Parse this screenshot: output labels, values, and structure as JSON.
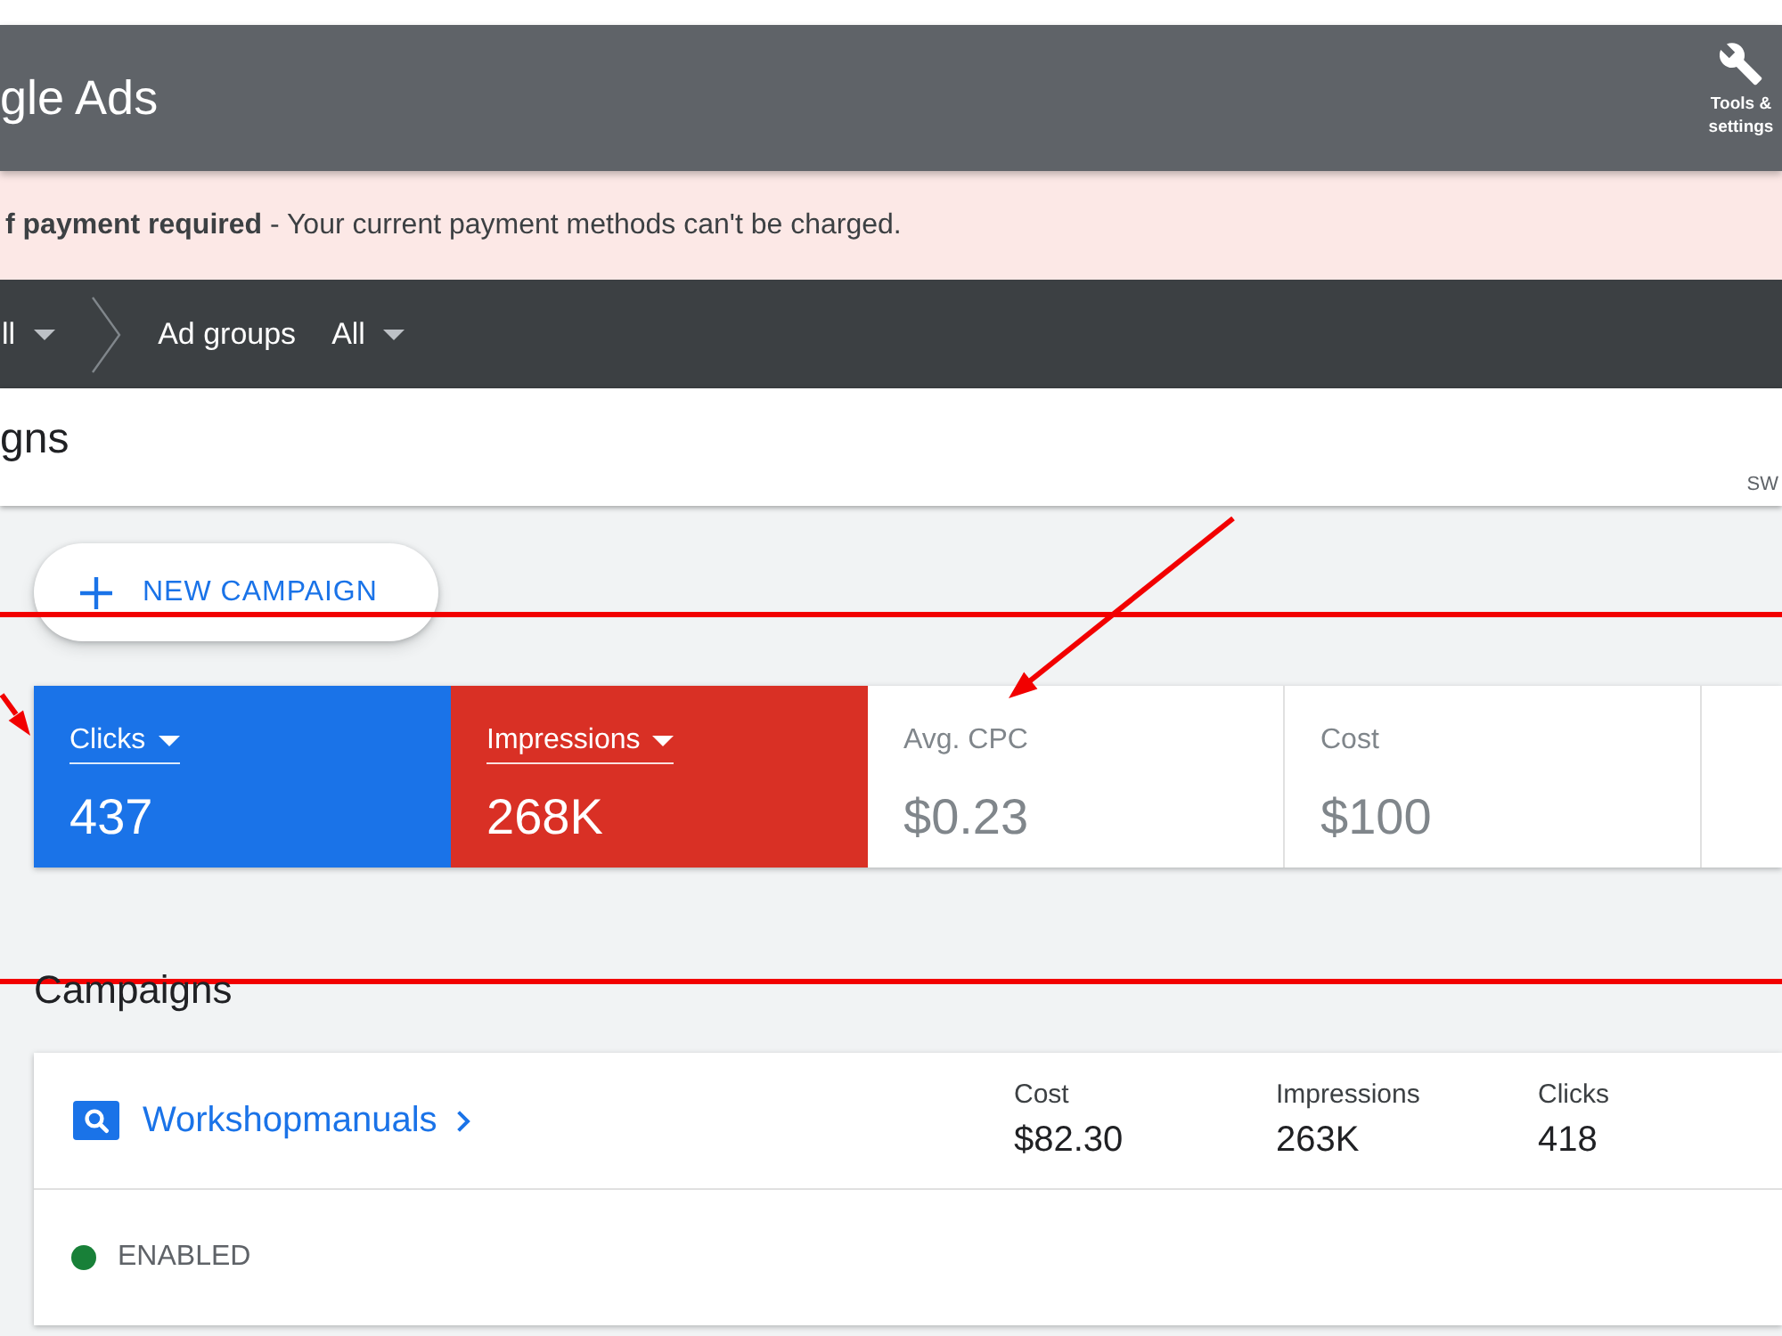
{
  "header": {
    "logo_text": "gle Ads",
    "tools_label": "Tools & settings"
  },
  "alert": {
    "message": "**f payment required** - Your current payment methods can't be charged."
  },
  "breadcrumbs": [
    {
      "filter": "ll"
    },
    {
      "label": "Ad groups",
      "filter": "All"
    }
  ],
  "title_bar": {
    "title": "gns",
    "corner_text": "SW"
  },
  "new_campaign_button": {
    "label": "NEW CAMPAIGN"
  },
  "metrics": [
    {
      "label": "Clicks",
      "value": "437",
      "selected": true,
      "color": "#1a73e8"
    },
    {
      "label": "Impressions",
      "value": "268K",
      "selected": true,
      "color": "#d93025"
    },
    {
      "label": "Avg. CPC",
      "value": "$0.23",
      "selected": false
    },
    {
      "label": "Cost",
      "value": "$100",
      "selected": false
    }
  ],
  "campaigns_heading": "Campaigns",
  "campaign": {
    "name": "Workshopmanuals",
    "stats": [
      {
        "label": "Cost",
        "value": "$82.30"
      },
      {
        "label": "Impressions",
        "value": "263K"
      },
      {
        "label": "Clicks",
        "value": "418"
      }
    ],
    "status": {
      "label": "ENABLED",
      "color": "#188038"
    }
  }
}
